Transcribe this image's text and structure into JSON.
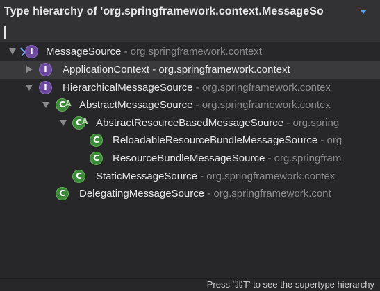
{
  "popup": {
    "title": "Type hierarchy of 'org.springframework.context.MessageSo",
    "search_value": ""
  },
  "tree": [
    {
      "name": "MessageSource",
      "package": " - org.springframework.context",
      "kind": "interface",
      "abstract": false,
      "expanded": true
    },
    {
      "name": "ApplicationContext",
      "package": " - org.springframework.context",
      "kind": "interface",
      "abstract": false,
      "expanded": false,
      "selected": true
    },
    {
      "name": "HierarchicalMessageSource",
      "package": " - org.springframework.contex",
      "kind": "interface",
      "abstract": false,
      "expanded": true
    },
    {
      "name": "AbstractMessageSource",
      "package": " - org.springframework.contex",
      "kind": "class",
      "abstract": true,
      "expanded": true
    },
    {
      "name": "AbstractResourceBasedMessageSource",
      "package": " - org.spring",
      "kind": "class",
      "abstract": true,
      "expanded": true
    },
    {
      "name": "ReloadableResourceBundleMessageSource",
      "package": " - org",
      "kind": "class",
      "abstract": false
    },
    {
      "name": "ResourceBundleMessageSource",
      "package": " - org.springfram",
      "kind": "class",
      "abstract": false
    },
    {
      "name": "StaticMessageSource",
      "package": " - org.springframework.contex",
      "kind": "class",
      "abstract": false
    },
    {
      "name": "DelegatingMessageSource",
      "package": " - org.springframework.cont",
      "kind": "class",
      "abstract": false
    }
  ],
  "icons": {
    "interface_glyph": "I",
    "class_glyph": "C",
    "abstract_glyph": "A"
  },
  "footer": {
    "hint": "Press '⌘T' to see the supertype hierarchy"
  },
  "colors": {
    "interface_icon": "#6c4a9e",
    "class_icon": "#3c8a3a",
    "accent": "#5ea3f2"
  }
}
